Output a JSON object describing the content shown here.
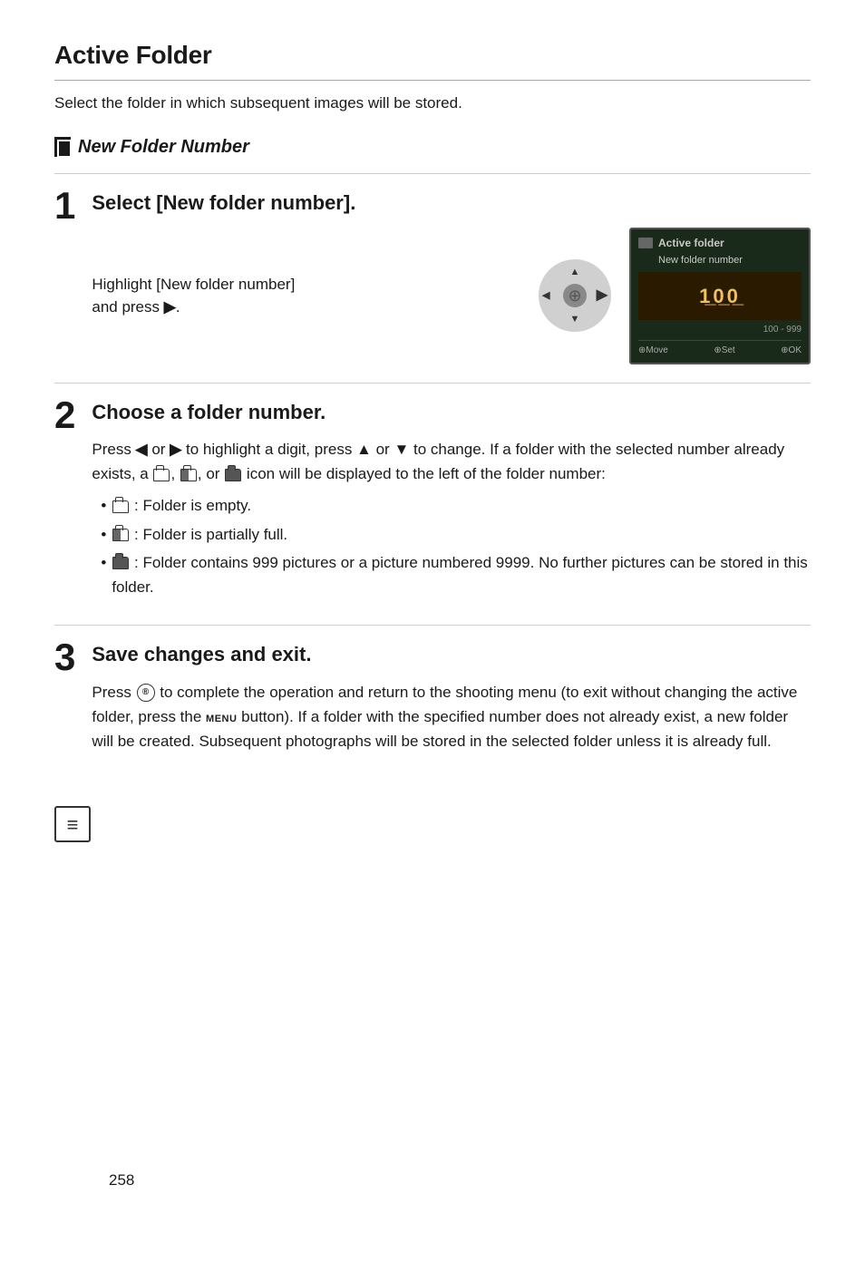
{
  "page": {
    "title": "Active Folder",
    "subtitle": "Select the folder in which subsequent images will be stored.",
    "page_number": "258"
  },
  "section": {
    "header": "New Folder Number"
  },
  "steps": [
    {
      "number": "1",
      "heading": "Select [New folder number].",
      "body": "Highlight [New folder number] and press ▶.",
      "lcd": {
        "title": "Active folder",
        "subtitle": "New folder number",
        "number": "100",
        "range": "100 - 999",
        "footer_move": "⊕Move",
        "footer_set": "⊕Set",
        "footer_ok": "⊕OK"
      }
    },
    {
      "number": "2",
      "heading": "Choose a folder number.",
      "body_intro": "Press ◀ or ▶ to highlight a digit, press ▲ or ▼ to change.  If a folder with the selected number already exists, a □, ■, or ▣ icon will be displayed to the left of the folder number:",
      "bullets": [
        "□ : Folder is empty.",
        "■ : Folder is partially full.",
        "▣ : Folder contains 999 pictures or a picture numbered 9999.  No further pictures can be stored in this folder."
      ]
    },
    {
      "number": "3",
      "heading": "Save changes and exit.",
      "body": "Press ⊕ to complete the operation and return to the shooting menu (to exit without changing the active folder, press the MENU button).  If a folder with the specified number does not already exist, a new folder will be created.  Subsequent photographs will be stored in the selected folder unless it is already full."
    }
  ]
}
